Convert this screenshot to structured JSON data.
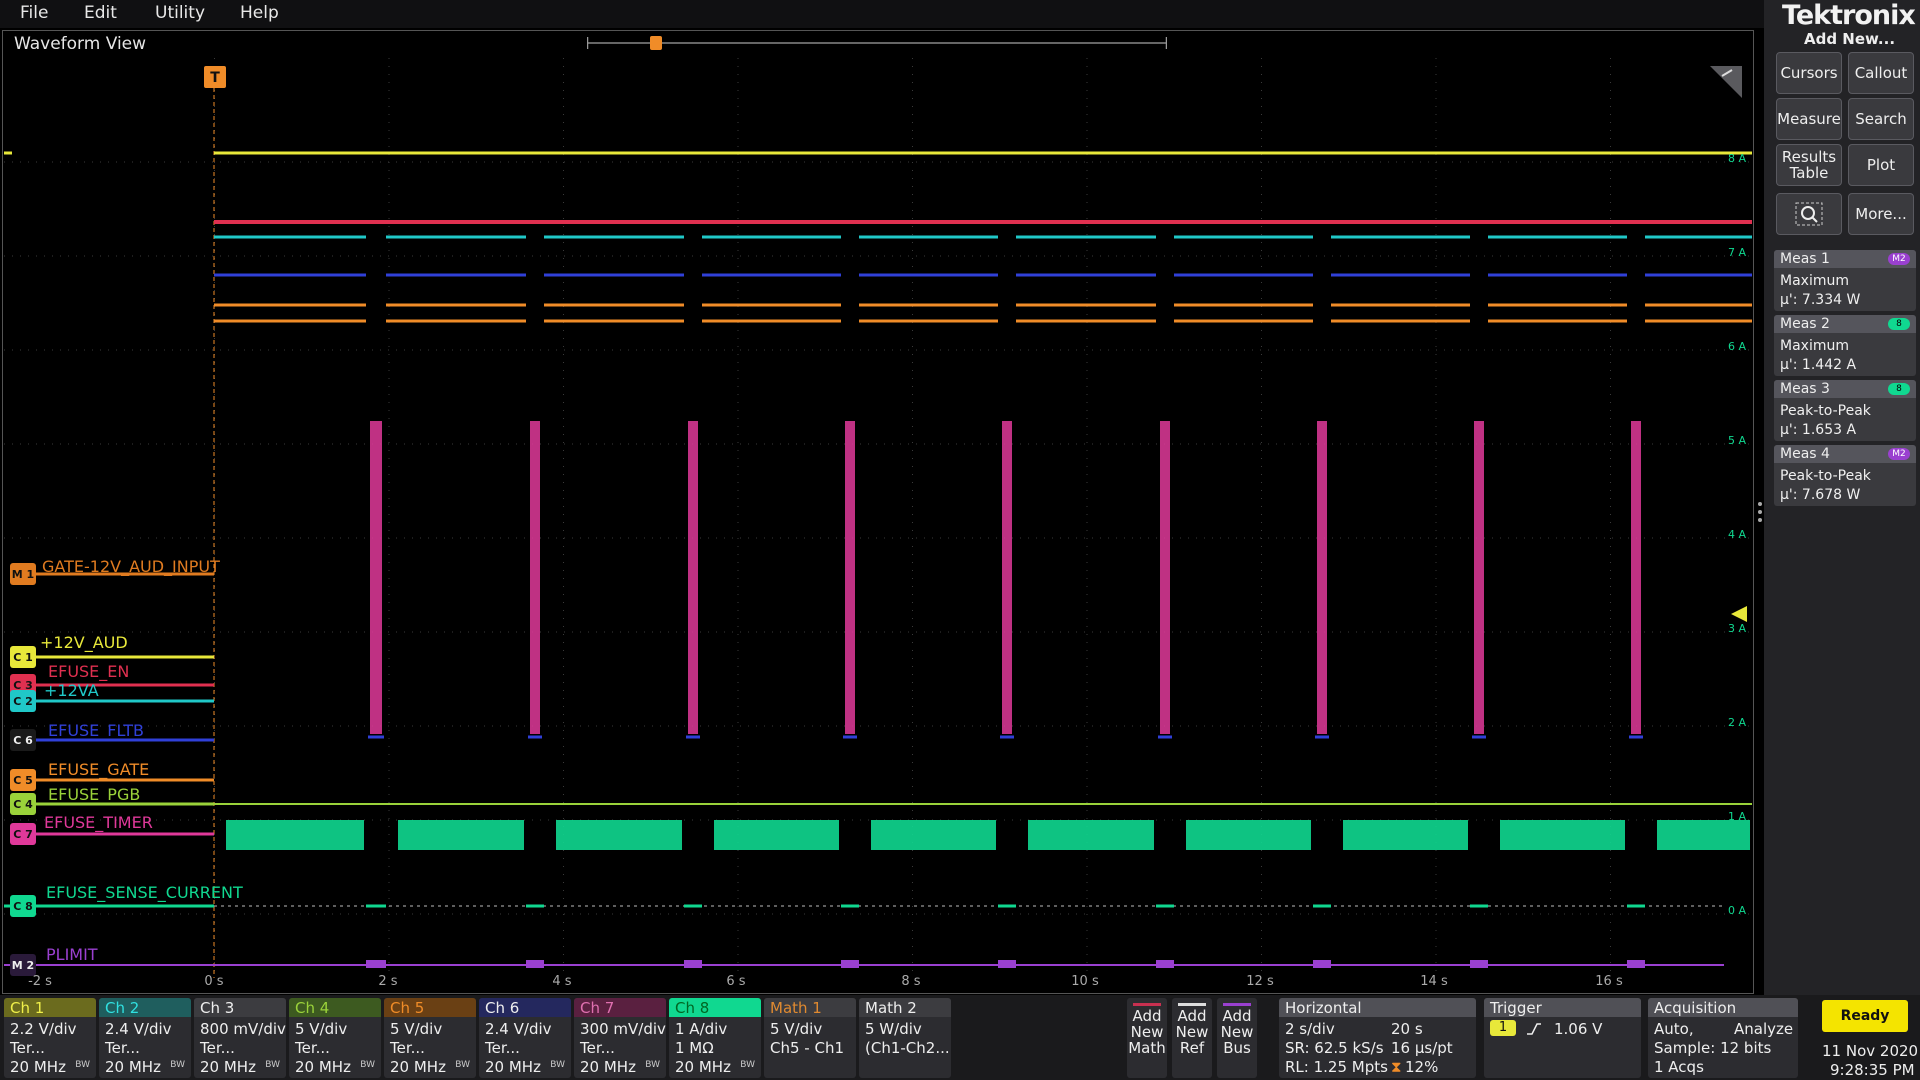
{
  "menu": {
    "file": "File",
    "edit": "Edit",
    "utility": "Utility",
    "help": "Help"
  },
  "waveform_view": {
    "title": "Waveform View"
  },
  "brand": {
    "logo": "Tektronix",
    "add_new": "Add New..."
  },
  "panel_buttons": {
    "cursors": "Cursors",
    "callout": "Callout",
    "measure": "Measure",
    "search": "Search",
    "results_line1": "Results",
    "results_line2": "Table",
    "plot": "Plot",
    "more": "More..."
  },
  "measurements": [
    {
      "title": "Meas 1",
      "badge": "M2",
      "type": "Maximum",
      "value": "µ': 7.334 W"
    },
    {
      "title": "Meas 2",
      "badge": "8",
      "type": "Maximum",
      "value": "µ': 1.442 A"
    },
    {
      "title": "Meas 3",
      "badge": "8",
      "type": "Peak-to-Peak",
      "value": "µ': 1.653 A"
    },
    {
      "title": "Meas 4",
      "badge": "M2",
      "type": "Peak-to-Peak",
      "value": "µ': 7.678 W"
    }
  ],
  "trace_labels": {
    "gate": "GATE-12V_AUD_INPUT",
    "v12aud": "+12V_AUD",
    "efuse_en": "EFUSE_EN",
    "v12va": "+12VA",
    "fltb": "EFUSE_FLTB",
    "gate_sig": "EFUSE_GATE",
    "pgb": "EFUSE_PGB",
    "timer": "EFUSE_TIMER",
    "sense": "EFUSE_SENSE_CURRENT",
    "plimit": "PLIMIT"
  },
  "trace_markers": {
    "m1": "M 1",
    "c1": "C 1",
    "c3": "C 3",
    "c2": "C 2",
    "c6": "C 6",
    "c5": "C 5",
    "c4": "C 4",
    "c7": "C 7",
    "c8": "C 8",
    "m2": "M 2"
  },
  "scope_readouts": {
    "trigger_letter": "T",
    "y_ticks": [
      "8 A",
      "7 A",
      "6 A",
      "5 A",
      "4 A",
      "3 A",
      "2 A",
      "1 A",
      "0 A"
    ],
    "x_ticks": [
      "-2 s",
      "0 s",
      "2 s",
      "4 s",
      "6 s",
      "8 s",
      "10 s",
      "12 s",
      "14 s",
      "16 s"
    ]
  },
  "colors": {
    "ch1": "#e8e83a",
    "ch2": "#20c8c8",
    "ch3": "#e03050",
    "ch4": "#9ad23a",
    "ch5": "#f08c28",
    "ch6": "#3040d8",
    "ch7": "#e0399a",
    "ch8": "#10d890",
    "math1": "#e07b20",
    "math2": "#9a40d0"
  },
  "channels": [
    {
      "name": "Ch 1",
      "l1": "2.2 V/div",
      "l2": "Ter...",
      "l3": "20 MHz",
      "bw": "BW",
      "color": "#c8c836"
    },
    {
      "name": "Ch 2",
      "l1": "2.4 V/div",
      "l2": "Ter...",
      "l3": "20 MHz",
      "bw": "BW",
      "color": "#20b0b0"
    },
    {
      "name": "Ch 3",
      "l1": "800 mV/div",
      "l2": "Ter...",
      "l3": "20 MHz",
      "bw": "BW",
      "color": "#c83050"
    },
    {
      "name": "Ch 4",
      "l1": "5 V/div",
      "l2": "Ter...",
      "l3": "20 MHz",
      "bw": "BW",
      "color": "#88b838"
    },
    {
      "name": "Ch 5",
      "l1": "5 V/div",
      "l2": "Ter...",
      "l3": "20 MHz",
      "bw": "BW",
      "color": "#d8802a"
    },
    {
      "name": "Ch 6",
      "l1": "2.4 V/div",
      "l2": "Ter...",
      "l3": "20 MHz",
      "bw": "BW",
      "color": "#3848c8"
    },
    {
      "name": "Ch 7",
      "l1": "300 mV/div",
      "l2": "Ter...",
      "l3": "20 MHz",
      "bw": "BW",
      "color": "#c83890"
    },
    {
      "name": "Ch 8",
      "l1": "1 A/div",
      "l2": "1 MΩ",
      "l3": "20 MHz",
      "bw": "BW",
      "color": "#10d890"
    },
    {
      "name": "Math 1",
      "l1": "5 V/div",
      "l2": "Ch5 - Ch1",
      "l3": "",
      "bw": "",
      "color": "#d87820"
    },
    {
      "name": "Math 2",
      "l1": "5 W/div",
      "l2": "(Ch1-Ch2...",
      "l3": "",
      "bw": "",
      "color": "#8a40c0"
    }
  ],
  "add_buttons": {
    "math": {
      "l1": "Add",
      "l2": "New",
      "l3": "Math"
    },
    "ref": {
      "l1": "Add",
      "l2": "New",
      "l3": "Ref"
    },
    "bus": {
      "l1": "Add",
      "l2": "New",
      "l3": "Bus"
    }
  },
  "horizontal": {
    "title": "Horizontal",
    "scale": "2 s/div",
    "record": "20 s",
    "sr": "SR: 62.5 kS/s",
    "pt": "16 µs/pt",
    "rl": "RL: 1.25 Mpts",
    "pct": "12%"
  },
  "trigger": {
    "title": "Trigger",
    "source": "1",
    "level": "1.06 V"
  },
  "acquisition": {
    "title": "Acquisition",
    "mode": "Auto,",
    "analyze": "Analyze",
    "sample": "Sample: 12 bits",
    "acqs": "1 Acqs"
  },
  "status": {
    "ready": "Ready",
    "date": "11 Nov 2020",
    "time": "9:28:35 PM"
  }
}
